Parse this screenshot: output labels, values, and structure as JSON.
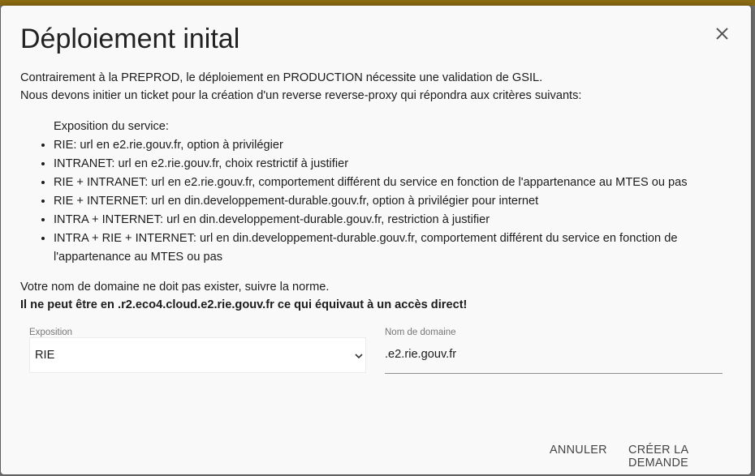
{
  "dialog": {
    "title": "Déploiement inital",
    "intro": [
      "Contrairement à la PREPROD, le déploiement en PRODUCTION nécessite une validation de GSIL.",
      "Nous devons initier un ticket pour la création d'un reverse reverse-proxy qui répondra aux critères suivants:"
    ],
    "criteria_heading": "Exposition du service:",
    "criteria": [
      "RIE: url en e2.rie.gouv.fr, option à privilégier",
      "INTRANET: url en e2.rie.gouv.fr, choix restrictif à justifier",
      "RIE + INTRANET: url en e2.rie.gouv.fr, comportement différent du service en fonction de l'appartenance au MTES ou pas",
      "RIE + INTERNET: url en din.developpement-durable.gouv.fr, option à privilégier pour internet",
      "INTRA + INTERNET: url en din.developpement-durable.gouv.fr, restriction à justifier",
      "INTRA + RIE + INTERNET: url en din.developpement-durable.gouv.fr, comportement différent du service en fonction de l'appartenance au MTES ou pas"
    ],
    "note": "Votre nom de domaine ne doit pas exister, suivre la norme.",
    "warning": "Il ne peut être en .r2.eco4.cloud.e2.rie.gouv.fr ce qui équivaut à un accès direct!",
    "exposition": {
      "label": "Exposition",
      "value": "RIE"
    },
    "domain": {
      "label": "Nom de domaine",
      "value": ".e2.rie.gouv.fr"
    },
    "cancel_label": "ANNULER",
    "submit_label": "CRÉER LA DEMANDE"
  },
  "icons": {
    "close": "close-icon",
    "chevron": "chevron-down-icon"
  }
}
